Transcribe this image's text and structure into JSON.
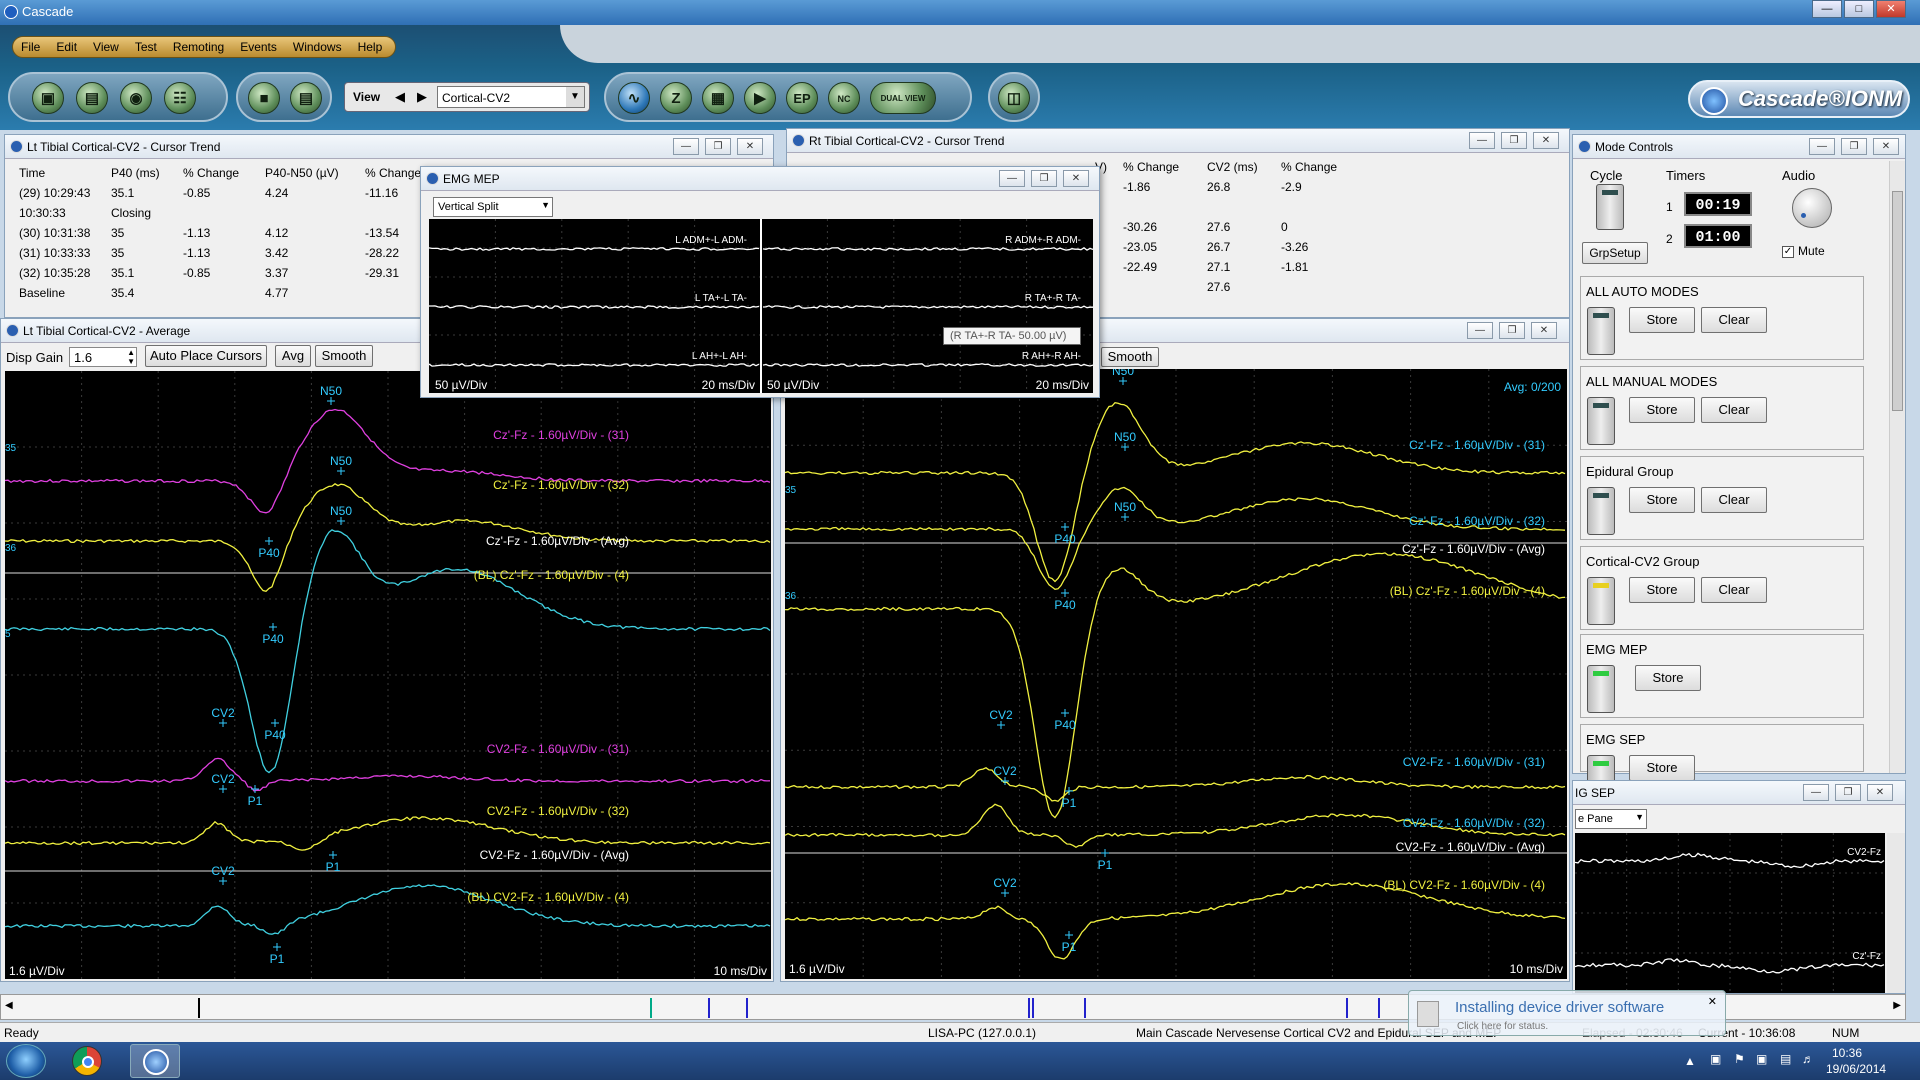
{
  "app": {
    "title": "Cascade",
    "brand": "Cascade®IONM"
  },
  "menu": [
    "File",
    "Edit",
    "View",
    "Test",
    "Remoting",
    "Events",
    "Windows",
    "Help"
  ],
  "view": {
    "label": "View",
    "value": "Cortical-CV2"
  },
  "toolbar": {
    "ep": "EP",
    "dual": "DUAL VIEW"
  },
  "lt_trend": {
    "title": "Lt Tibial Cortical-CV2 - Cursor Trend",
    "headers": [
      "Time",
      "P40 (ms)",
      "% Change",
      "P40-N50 (µV)",
      "% Change"
    ],
    "rows": [
      [
        "(29) 10:29:43",
        "35.1",
        "-0.85",
        "4.24",
        "-11.16"
      ],
      [
        "10:30:33",
        "Closing",
        "",
        "",
        ""
      ],
      [
        "(30) 10:31:38",
        "35",
        "-1.13",
        "4.12",
        "-13.54"
      ],
      [
        "(31) 10:33:33",
        "35",
        "-1.13",
        "3.42",
        "-28.22"
      ],
      [
        "(32) 10:35:28",
        "35.1",
        "-0.85",
        "3.37",
        "-29.31"
      ],
      [
        "Baseline",
        "35.4",
        "",
        "4.77",
        ""
      ]
    ]
  },
  "rt_trend": {
    "title": "Rt Tibial Cortical-CV2 - Cursor Trend",
    "headers": [
      "V)",
      "% Change",
      "CV2 (ms)",
      "% Change"
    ],
    "rows": [
      [
        "",
        "-1.86",
        "26.8",
        "-2.9"
      ],
      [
        "",
        "",
        "",
        ""
      ],
      [
        "",
        "-30.26",
        "27.6",
        "0"
      ],
      [
        "",
        "-23.05",
        "26.7",
        "-3.26"
      ],
      [
        "",
        "-22.49",
        "27.1",
        "-1.81"
      ],
      [
        "",
        "",
        "27.6",
        ""
      ]
    ]
  },
  "emg": {
    "title": "EMG MEP",
    "split": "Vertical Split",
    "left": {
      "labels": [
        "L ADM+-L ADM-",
        "L TA+-L TA-",
        "L AH+-L AH-"
      ],
      "scale": "50 µV/Div",
      "time": "20 ms/Div"
    },
    "right": {
      "labels": [
        "R ADM+-R ADM-",
        "R TA+-R TA-",
        "R AH+-R AH-"
      ],
      "scale": "50 µV/Div",
      "time": "20 ms/Div"
    },
    "tooltip": "(R TA+-R TA- 50.00 µV)"
  },
  "lt_avg": {
    "title": "Lt Tibial Cortical-CV2 - Average",
    "disp_gain_label": "Disp Gain",
    "disp_gain": "1.6",
    "buttons": [
      "Auto Place Cursors",
      "Avg",
      "Smooth"
    ],
    "traces": [
      "Cz'-Fz - 1.60µV/Div - (31)",
      "Cz'-Fz - 1.60µV/Div - (32)",
      "Cz'-Fz - 1.60µV/Div - (Avg)",
      "(BL) Cz'-Fz - 1.60µV/Div - (4)",
      "CV2-Fz - 1.60µV/Div - (31)",
      "CV2-Fz - 1.60µV/Div - (32)",
      "CV2-Fz - 1.60µV/Div - (Avg)",
      "(BL) CV2-Fz - 1.60µV/Div - (4)"
    ],
    "markers": [
      "N50",
      "N50",
      "N50",
      "P40",
      "P40",
      "P40",
      "CV2",
      "CV2",
      "CV2",
      "P1",
      "P1",
      "P1"
    ],
    "scale": "1.6 µV/Div",
    "time": "10 ms/Div",
    "edge": [
      "35",
      "36",
      "5"
    ]
  },
  "rt_avg": {
    "smooth": "Smooth",
    "avg_count": "Avg: 0/200",
    "traces": [
      "Cz'-Fz - 1.60µV/Div - (31)",
      "Cz'-Fz - 1.60µV/Div - (32)",
      "Cz'-Fz - 1.60µV/Div - (Avg)",
      "(BL) Cz'-Fz - 1.60µV/Div - (4)",
      "CV2-Fz - 1.60µV/Div - (31)",
      "CV2-Fz - 1.60µV/Div - (32)",
      "CV2-Fz - 1.60µV/Div - (Avg)",
      "(BL) CV2-Fz - 1.60µV/Div - (4)"
    ],
    "markers": [
      "N50",
      "N50",
      "N50",
      "P40",
      "P40",
      "P40",
      "CV2",
      "CV2",
      "CV2",
      "P1",
      "P1",
      "P1"
    ],
    "scale": "1.6 µV/Div",
    "time": "10 ms/Div",
    "edge": [
      "35",
      "36"
    ]
  },
  "mode": {
    "title": "Mode Controls",
    "cycle": "Cycle",
    "timers": "Timers",
    "audio": "Audio",
    "timer1_idx": "1",
    "timer1": "00:19",
    "timer2_idx": "2",
    "timer2": "01:00",
    "grpsetup": "GrpSetup",
    "mute": "Mute",
    "groups": [
      {
        "name": "ALL AUTO MODES",
        "store": "Store",
        "clear": "Clear"
      },
      {
        "name": "ALL MANUAL MODES",
        "store": "Store",
        "clear": "Clear"
      },
      {
        "name": "Epidural Group",
        "store": "Store",
        "clear": "Clear"
      },
      {
        "name": "Cortical-CV2 Group",
        "store": "Store",
        "clear": "Clear"
      },
      {
        "name": "EMG MEP",
        "store": "Store"
      },
      {
        "name": "EMG SEP",
        "store": "Store"
      }
    ]
  },
  "sep": {
    "title": "IG SEP",
    "pane": "e Pane",
    "labels": [
      "CV2-Fz",
      "Cz'-Fz"
    ]
  },
  "status": {
    "ready": "Ready",
    "host": "LISA-PC (127.0.0.1)",
    "main": "Main Cascade Nervesense Cortical CV2 and Epidural SEP and MEP",
    "elapsed": "Elapsed - 02:30:46",
    "current": "Current - 10:36:08",
    "num": "NUM"
  },
  "notify": {
    "title": "Installing device driver software",
    "sub": "Click here for status."
  },
  "clock": {
    "time": "10:36",
    "date": "19/06/2014"
  }
}
